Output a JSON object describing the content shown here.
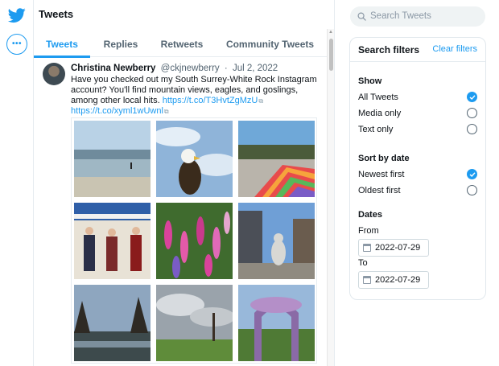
{
  "header": {
    "title": "Tweets"
  },
  "tabs": [
    {
      "label": "Tweets",
      "active": true
    },
    {
      "label": "Replies",
      "active": false
    },
    {
      "label": "Retweets",
      "active": false
    },
    {
      "label": "Community Tweets",
      "active": false
    }
  ],
  "tweet": {
    "name": "Christina Newberry",
    "handle": "@ckjnewberry",
    "separator": "·",
    "date": "Jul 2, 2022",
    "text": "Have you checked out my South Surrey-White Rock Instagram account? You'll find mountain views, eagles, and goslings, among other local hits.",
    "link1": "https://t.co/T3HvtZgMzU",
    "link2": "https://t.co/xyml1wUwnl",
    "photo_count": 9
  },
  "search": {
    "placeholder": "Search Tweets"
  },
  "filters": {
    "title": "Search filters",
    "clear_label": "Clear filters",
    "show": {
      "heading": "Show",
      "options": [
        {
          "label": "All Tweets",
          "checked": true
        },
        {
          "label": "Media only",
          "checked": false
        },
        {
          "label": "Text only",
          "checked": false
        }
      ]
    },
    "sort": {
      "heading": "Sort by date",
      "options": [
        {
          "label": "Newest first",
          "checked": true
        },
        {
          "label": "Oldest first",
          "checked": false
        }
      ]
    },
    "dates": {
      "heading": "Dates",
      "from_label": "From",
      "from_value": "2022-07-29",
      "to_label": "To",
      "to_value": "2022-07-29"
    }
  },
  "colors": {
    "accent": "#1d9bf0",
    "text": "#0f1419",
    "muted": "#536471",
    "border": "#e6ecf0"
  },
  "icons": [
    "twitter-bird-icon",
    "more-options-icon",
    "search-icon",
    "calendar-icon",
    "external-link-icon",
    "check-icon"
  ]
}
